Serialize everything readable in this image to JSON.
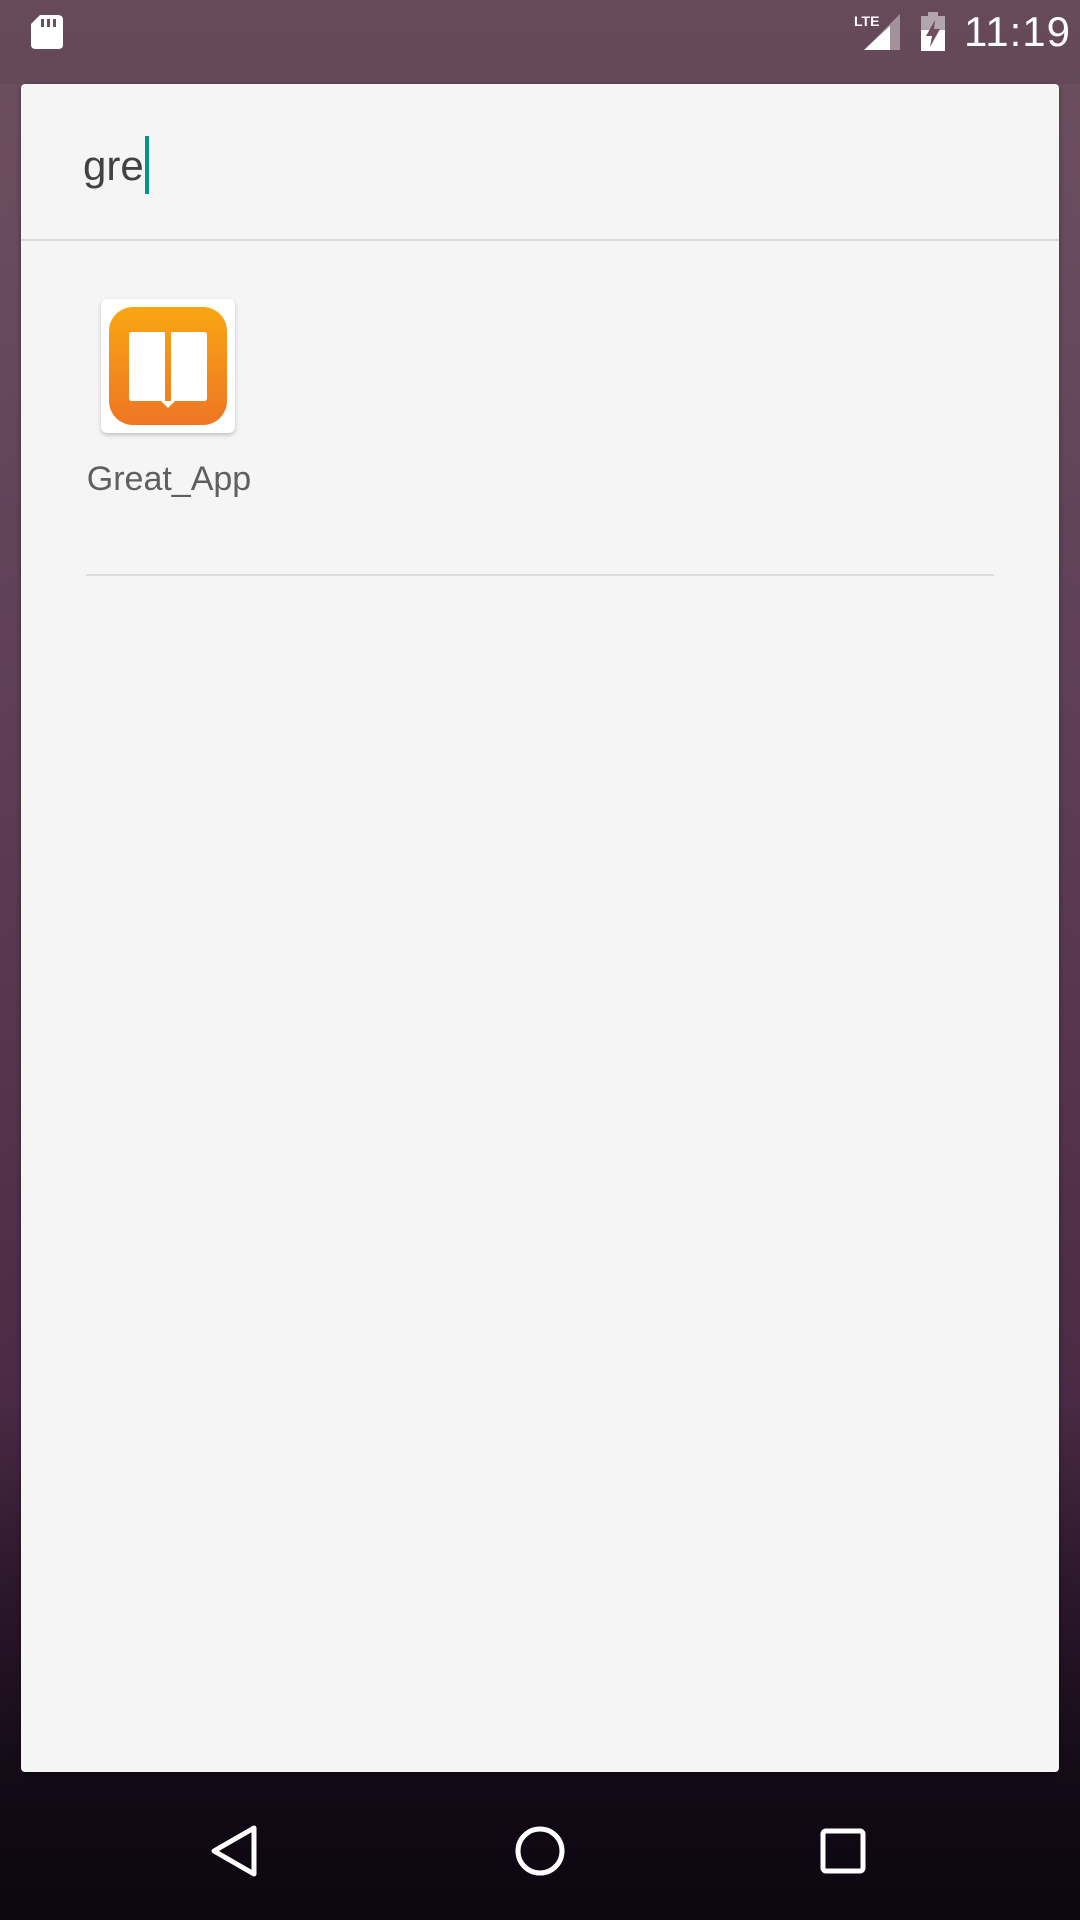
{
  "status_bar": {
    "time": "11:19",
    "network": "LTE",
    "icons": [
      "sd-card-icon",
      "lte-signal-icon",
      "battery-charging-icon"
    ]
  },
  "search": {
    "query": "gre"
  },
  "results": [
    {
      "label": "Great_App",
      "icon": "book-icon"
    }
  ],
  "nav_bar": {
    "buttons": [
      "back-icon",
      "home-icon",
      "recents-icon"
    ]
  },
  "colors": {
    "cursor": "#009688",
    "icon_top": "#f9a612",
    "icon_bottom": "#ee7624"
  }
}
